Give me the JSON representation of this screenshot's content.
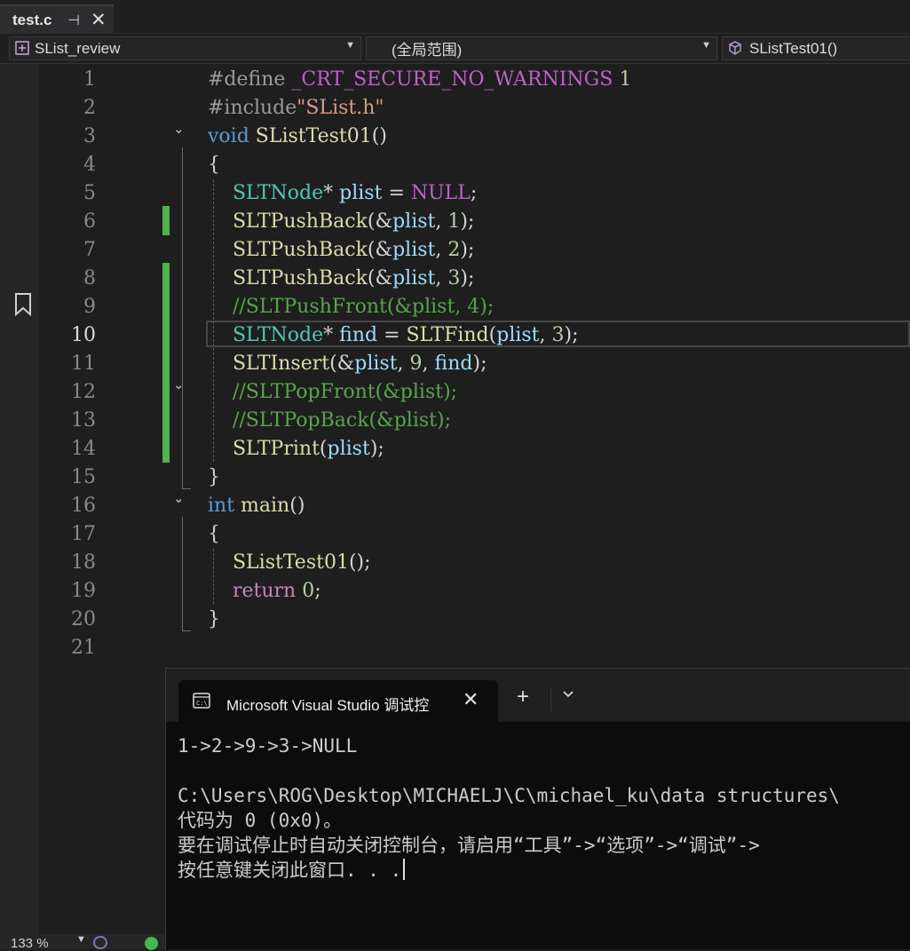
{
  "tab": {
    "file_name": "test.c",
    "pin_glyph": "⊣",
    "close_glyph": "✕"
  },
  "nav": {
    "project": "SList_review",
    "scope": "(全局范围)",
    "function": "SListTest01()",
    "caret_glyph": "▼"
  },
  "editor": {
    "active_line": 10,
    "line_numbers": [
      "1",
      "2",
      "3",
      "4",
      "5",
      "6",
      "7",
      "8",
      "9",
      "10",
      "11",
      "12",
      "13",
      "14",
      "15",
      "16",
      "17",
      "18",
      "19",
      "20",
      "21"
    ],
    "fold_glyph": "⌄",
    "lines": [
      [
        [
          "k-pre",
          "#define"
        ],
        [
          "k-punc",
          " "
        ],
        [
          "k-mac",
          "_CRT_SECURE_NO_WARNINGS"
        ],
        [
          "k-punc",
          " "
        ],
        [
          "k-num",
          "1"
        ]
      ],
      [
        [
          "k-pre",
          "#include"
        ],
        [
          "k-str",
          "\"SList.h\""
        ]
      ],
      [
        [
          "k-kw",
          "void"
        ],
        [
          "k-punc",
          " "
        ],
        [
          "k-fn",
          "SListTest01"
        ],
        [
          "k-punc",
          "()"
        ]
      ],
      [
        [
          "k-punc",
          "{"
        ]
      ],
      [
        [
          "k-punc",
          "    "
        ],
        [
          "k-type",
          "SLTNode"
        ],
        [
          "k-punc",
          "* "
        ],
        [
          "k-var",
          "plist"
        ],
        [
          "k-punc",
          " = "
        ],
        [
          "k-mac",
          "NULL"
        ],
        [
          "k-punc",
          ";"
        ]
      ],
      [
        [
          "k-punc",
          "    "
        ],
        [
          "k-fn",
          "SLTPushBack"
        ],
        [
          "k-punc",
          "(&"
        ],
        [
          "k-var",
          "plist"
        ],
        [
          "k-punc",
          ", "
        ],
        [
          "k-num",
          "1"
        ],
        [
          "k-punc",
          ");"
        ]
      ],
      [
        [
          "k-punc",
          "    "
        ],
        [
          "k-fn",
          "SLTPushBack"
        ],
        [
          "k-punc",
          "(&"
        ],
        [
          "k-var",
          "plist"
        ],
        [
          "k-punc",
          ", "
        ],
        [
          "k-num",
          "2"
        ],
        [
          "k-punc",
          ");"
        ]
      ],
      [
        [
          "k-punc",
          "    "
        ],
        [
          "k-fn",
          "SLTPushBack"
        ],
        [
          "k-punc",
          "(&"
        ],
        [
          "k-var",
          "plist"
        ],
        [
          "k-punc",
          ", "
        ],
        [
          "k-num",
          "3"
        ],
        [
          "k-punc",
          ");"
        ]
      ],
      [
        [
          "k-punc",
          "    "
        ],
        [
          "k-cm",
          "//SLTPushFront(&plist, 4);"
        ]
      ],
      [
        [
          "k-punc",
          "    "
        ],
        [
          "k-type",
          "SLTNode"
        ],
        [
          "k-punc",
          "* "
        ],
        [
          "k-var",
          "find"
        ],
        [
          "k-punc",
          " = "
        ],
        [
          "k-fn",
          "SLTFind"
        ],
        [
          "k-punc",
          "("
        ],
        [
          "k-var",
          "plist"
        ],
        [
          "k-punc",
          ", "
        ],
        [
          "k-num",
          "3"
        ],
        [
          "k-punc",
          ");"
        ]
      ],
      [
        [
          "k-punc",
          "    "
        ],
        [
          "k-fn",
          "SLTInsert"
        ],
        [
          "k-punc",
          "(&"
        ],
        [
          "k-var",
          "plist"
        ],
        [
          "k-punc",
          ", "
        ],
        [
          "k-num",
          "9"
        ],
        [
          "k-punc",
          ", "
        ],
        [
          "k-var",
          "find"
        ],
        [
          "k-punc",
          ");"
        ]
      ],
      [
        [
          "k-punc",
          "    "
        ],
        [
          "k-cm",
          "//SLTPopFront(&plist);"
        ]
      ],
      [
        [
          "k-punc",
          "    "
        ],
        [
          "k-cm",
          "//SLTPopBack(&plist);"
        ]
      ],
      [
        [
          "k-punc",
          "    "
        ],
        [
          "k-fn",
          "SLTPrint"
        ],
        [
          "k-punc",
          "("
        ],
        [
          "k-var",
          "plist"
        ],
        [
          "k-punc",
          ");"
        ]
      ],
      [
        [
          "k-punc",
          "}"
        ]
      ],
      [
        [
          "k-kw",
          "int"
        ],
        [
          "k-punc",
          " "
        ],
        [
          "k-fn",
          "main"
        ],
        [
          "k-punc",
          "()"
        ]
      ],
      [
        [
          "k-punc",
          "{"
        ]
      ],
      [
        [
          "k-punc",
          "    "
        ],
        [
          "k-fn",
          "SListTest01"
        ],
        [
          "k-punc",
          "();"
        ]
      ],
      [
        [
          "k-punc",
          "    "
        ],
        [
          "k-ret",
          "return"
        ],
        [
          "k-punc",
          " "
        ],
        [
          "k-num",
          "0"
        ],
        [
          "k-punc",
          ";"
        ]
      ],
      [
        [
          "k-punc",
          "}"
        ]
      ],
      [
        [
          "k-punc",
          ""
        ]
      ]
    ]
  },
  "status": {
    "zoom": "133 %",
    "caret_glyph": "▼"
  },
  "terminal": {
    "tab_title": "Microsoft Visual Studio 调试控",
    "close_glyph": "✕",
    "new_tab_glyph": "+",
    "output": [
      "1->2->9->3->NULL",
      "",
      "C:\\Users\\ROG\\Desktop\\MICHAELJ\\C\\michael_ku\\data structures\\",
      "代码为 0 (0x0)。",
      "要在调试停止时自动关闭控制台，请启用“工具”->“选项”->“调试”->",
      "按任意键关闭此窗口. . ."
    ]
  },
  "colors": {
    "editor_bg": "#1e1e1e",
    "change_bar": "#4db34d",
    "terminal_bg": "#0c0c0c"
  }
}
